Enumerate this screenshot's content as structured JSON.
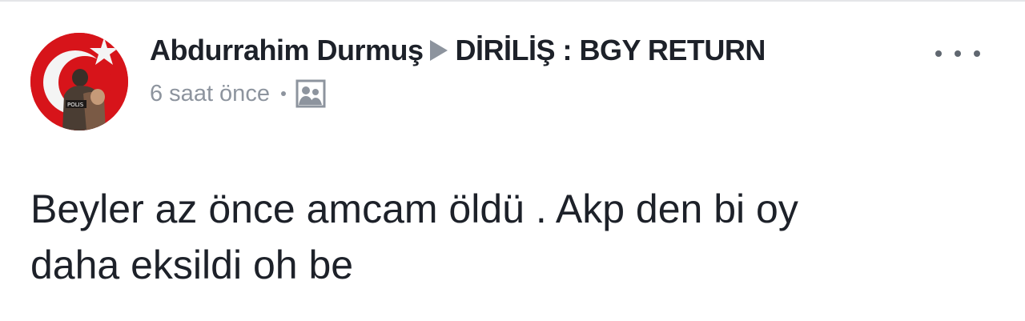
{
  "post": {
    "author": "Abdurrahim Durmuş",
    "group": "DİRİLİŞ : BGY RETURN",
    "timestamp": "6 saat önce",
    "privacy_icon": "group-photo-icon",
    "more_icon": "more-options-icon",
    "text": "Beyler az önce amcam öldü . Akp den bi oy\ndaha eksildi oh be"
  },
  "avatar": {
    "badge_text": "POLIS",
    "icon": "turkish-flag-avatar"
  },
  "colors": {
    "text_primary": "#1d2129",
    "text_secondary": "#8d949e",
    "flag_red": "#d7141a"
  }
}
